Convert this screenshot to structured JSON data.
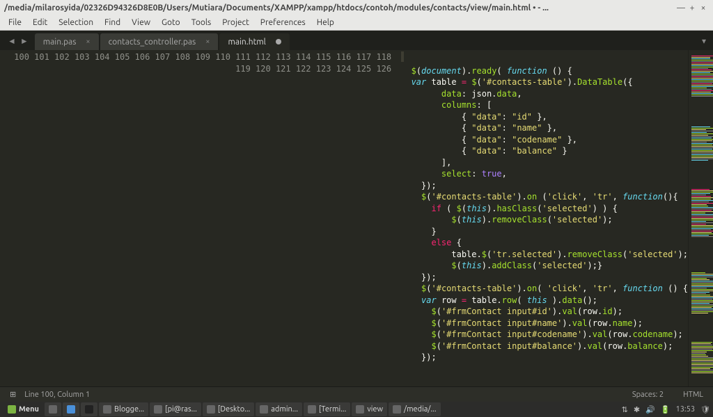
{
  "window": {
    "title": "/media/milarosyida/02326D94326D8E0B/Users/Mutiara/Documents/XAMPP/xampp/htdocs/contoh/modules/contacts/view/main.html • - ... "
  },
  "menu": {
    "items": [
      "File",
      "Edit",
      "Selection",
      "Find",
      "View",
      "Goto",
      "Tools",
      "Project",
      "Preferences",
      "Help"
    ]
  },
  "tabs": [
    {
      "label": "main.pas",
      "active": false,
      "modified": false
    },
    {
      "label": "contacts_controller.pas",
      "active": false,
      "modified": false
    },
    {
      "label": "main.html",
      "active": true,
      "modified": true
    }
  ],
  "gutter": {
    "start": 100,
    "end": 126
  },
  "code": [
    [],
    [
      [
        "c",
        "  "
      ],
      [
        "f",
        "$"
      ],
      [
        "c",
        "("
      ],
      [
        "v",
        "document"
      ],
      [
        "c",
        ")."
      ],
      [
        "f",
        "ready"
      ],
      [
        "c",
        "( "
      ],
      [
        "v",
        "function"
      ],
      [
        "c",
        " () {"
      ]
    ],
    [
      [
        "c",
        "  "
      ],
      [
        "v",
        "var"
      ],
      [
        "c",
        " table "
      ],
      [
        "k",
        "="
      ],
      [
        "c",
        " "
      ],
      [
        "f",
        "$"
      ],
      [
        "c",
        "("
      ],
      [
        "s",
        "'#contacts-table'"
      ],
      [
        "c",
        ")."
      ],
      [
        "f",
        "DataTable"
      ],
      [
        "c",
        "({"
      ]
    ],
    [
      [
        "c",
        "        "
      ],
      [
        "f",
        "data"
      ],
      [
        "c",
        ": json."
      ],
      [
        "f",
        "data"
      ],
      [
        "c",
        ","
      ]
    ],
    [
      [
        "c",
        "        "
      ],
      [
        "f",
        "columns"
      ],
      [
        "c",
        ": ["
      ]
    ],
    [
      [
        "c",
        "            { "
      ],
      [
        "s",
        "\"data\""
      ],
      [
        "c",
        ": "
      ],
      [
        "s",
        "\"id\""
      ],
      [
        "c",
        " },"
      ]
    ],
    [
      [
        "c",
        "            { "
      ],
      [
        "s",
        "\"data\""
      ],
      [
        "c",
        ": "
      ],
      [
        "s",
        "\"name\""
      ],
      [
        "c",
        " },"
      ]
    ],
    [
      [
        "c",
        "            { "
      ],
      [
        "s",
        "\"data\""
      ],
      [
        "c",
        ": "
      ],
      [
        "s",
        "\"codename\""
      ],
      [
        "c",
        " },"
      ]
    ],
    [
      [
        "c",
        "            { "
      ],
      [
        "s",
        "\"data\""
      ],
      [
        "c",
        ": "
      ],
      [
        "s",
        "\"balance\""
      ],
      [
        "c",
        " }"
      ]
    ],
    [
      [
        "c",
        "        ],"
      ]
    ],
    [
      [
        "c",
        "        "
      ],
      [
        "f",
        "select"
      ],
      [
        "c",
        ": "
      ],
      [
        "b",
        "true"
      ],
      [
        "c",
        ","
      ]
    ],
    [
      [
        "c",
        "    });"
      ]
    ],
    [
      [
        "c",
        "    "
      ],
      [
        "f",
        "$"
      ],
      [
        "c",
        "("
      ],
      [
        "s",
        "'#contacts-table'"
      ],
      [
        "c",
        ")."
      ],
      [
        "f",
        "on"
      ],
      [
        "c",
        " ("
      ],
      [
        "s",
        "'click'"
      ],
      [
        "c",
        ", "
      ],
      [
        "s",
        "'tr'"
      ],
      [
        "c",
        ", "
      ],
      [
        "v",
        "function"
      ],
      [
        "c",
        "(){"
      ]
    ],
    [
      [
        "c",
        "      "
      ],
      [
        "k",
        "if"
      ],
      [
        "c",
        " ( "
      ],
      [
        "f",
        "$"
      ],
      [
        "c",
        "("
      ],
      [
        "v",
        "this"
      ],
      [
        "c",
        ")."
      ],
      [
        "f",
        "hasClass"
      ],
      [
        "c",
        "("
      ],
      [
        "s",
        "'selected'"
      ],
      [
        "c",
        ") ) {"
      ]
    ],
    [
      [
        "c",
        "          "
      ],
      [
        "f",
        "$"
      ],
      [
        "c",
        "("
      ],
      [
        "v",
        "this"
      ],
      [
        "c",
        ")."
      ],
      [
        "f",
        "removeClass"
      ],
      [
        "c",
        "("
      ],
      [
        "s",
        "'selected'"
      ],
      [
        "c",
        ");"
      ]
    ],
    [
      [
        "c",
        "      }"
      ]
    ],
    [
      [
        "c",
        "      "
      ],
      [
        "k",
        "else"
      ],
      [
        "c",
        " {"
      ]
    ],
    [
      [
        "c",
        "          table."
      ],
      [
        "f",
        "$"
      ],
      [
        "c",
        "("
      ],
      [
        "s",
        "'tr.selected'"
      ],
      [
        "c",
        ")."
      ],
      [
        "f",
        "removeClass"
      ],
      [
        "c",
        "("
      ],
      [
        "s",
        "'selected'"
      ],
      [
        "c",
        ");"
      ]
    ],
    [
      [
        "c",
        "          "
      ],
      [
        "f",
        "$"
      ],
      [
        "c",
        "("
      ],
      [
        "v",
        "this"
      ],
      [
        "c",
        ")."
      ],
      [
        "f",
        "addClass"
      ],
      [
        "c",
        "("
      ],
      [
        "s",
        "'selected'"
      ],
      [
        "c",
        ");}"
      ]
    ],
    [
      [
        "c",
        "    });"
      ]
    ],
    [
      [
        "c",
        "    "
      ],
      [
        "f",
        "$"
      ],
      [
        "c",
        "("
      ],
      [
        "s",
        "'#contacts-table'"
      ],
      [
        "c",
        ")."
      ],
      [
        "f",
        "on"
      ],
      [
        "c",
        "( "
      ],
      [
        "s",
        "'click'"
      ],
      [
        "c",
        ", "
      ],
      [
        "s",
        "'tr'"
      ],
      [
        "c",
        ", "
      ],
      [
        "v",
        "function"
      ],
      [
        "c",
        " () {"
      ]
    ],
    [
      [
        "c",
        "    "
      ],
      [
        "v",
        "var"
      ],
      [
        "c",
        " row "
      ],
      [
        "k",
        "="
      ],
      [
        "c",
        " table."
      ],
      [
        "f",
        "row"
      ],
      [
        "c",
        "( "
      ],
      [
        "v",
        "this"
      ],
      [
        "c",
        " )."
      ],
      [
        "f",
        "data"
      ],
      [
        "c",
        "();"
      ]
    ],
    [
      [
        "c",
        "      "
      ],
      [
        "f",
        "$"
      ],
      [
        "c",
        "("
      ],
      [
        "s",
        "'#frmContact input#id'"
      ],
      [
        "c",
        ")."
      ],
      [
        "f",
        "val"
      ],
      [
        "c",
        "(row."
      ],
      [
        "f",
        "id"
      ],
      [
        "c",
        ");"
      ]
    ],
    [
      [
        "c",
        "      "
      ],
      [
        "f",
        "$"
      ],
      [
        "c",
        "("
      ],
      [
        "s",
        "'#frmContact input#name'"
      ],
      [
        "c",
        ")."
      ],
      [
        "f",
        "val"
      ],
      [
        "c",
        "(row."
      ],
      [
        "f",
        "name"
      ],
      [
        "c",
        ");"
      ]
    ],
    [
      [
        "c",
        "      "
      ],
      [
        "f",
        "$"
      ],
      [
        "c",
        "("
      ],
      [
        "s",
        "'#frmContact input#codename'"
      ],
      [
        "c",
        ")."
      ],
      [
        "f",
        "val"
      ],
      [
        "c",
        "(row."
      ],
      [
        "f",
        "codename"
      ],
      [
        "c",
        ");"
      ]
    ],
    [
      [
        "c",
        "      "
      ],
      [
        "f",
        "$"
      ],
      [
        "c",
        "("
      ],
      [
        "s",
        "'#frmContact input#balance'"
      ],
      [
        "c",
        ")."
      ],
      [
        "f",
        "val"
      ],
      [
        "c",
        "(row."
      ],
      [
        "f",
        "balance"
      ],
      [
        "c",
        ");"
      ]
    ],
    [
      [
        "c",
        "    });"
      ]
    ]
  ],
  "statusbar": {
    "left_icon": "⊞",
    "position": "Line 100, Column 1",
    "spaces": "Spaces: 2",
    "syntax": "HTML"
  },
  "taskbar": {
    "menu": "Menu",
    "items": [
      "Blogge...",
      "[pi@ras...",
      "[Deskto...",
      "admin...",
      "[Termi...",
      "view",
      "/media/..."
    ],
    "tray": {
      "time": "13:53"
    }
  }
}
